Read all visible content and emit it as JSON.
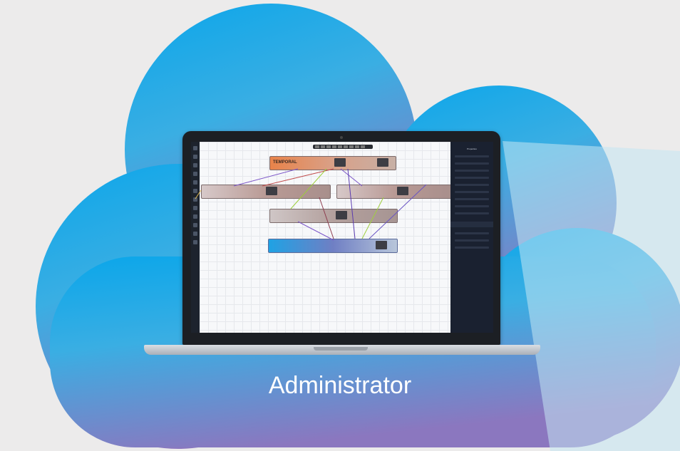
{
  "label": "Administrator",
  "app": {
    "header_title": "TEMPORAL",
    "panel_title": "Properties"
  },
  "colors": {
    "cloud_top": "#0ea9e8",
    "cloud_bottom": "#8b77c0",
    "panel": "#1a2130",
    "accent": "#e8834a"
  }
}
